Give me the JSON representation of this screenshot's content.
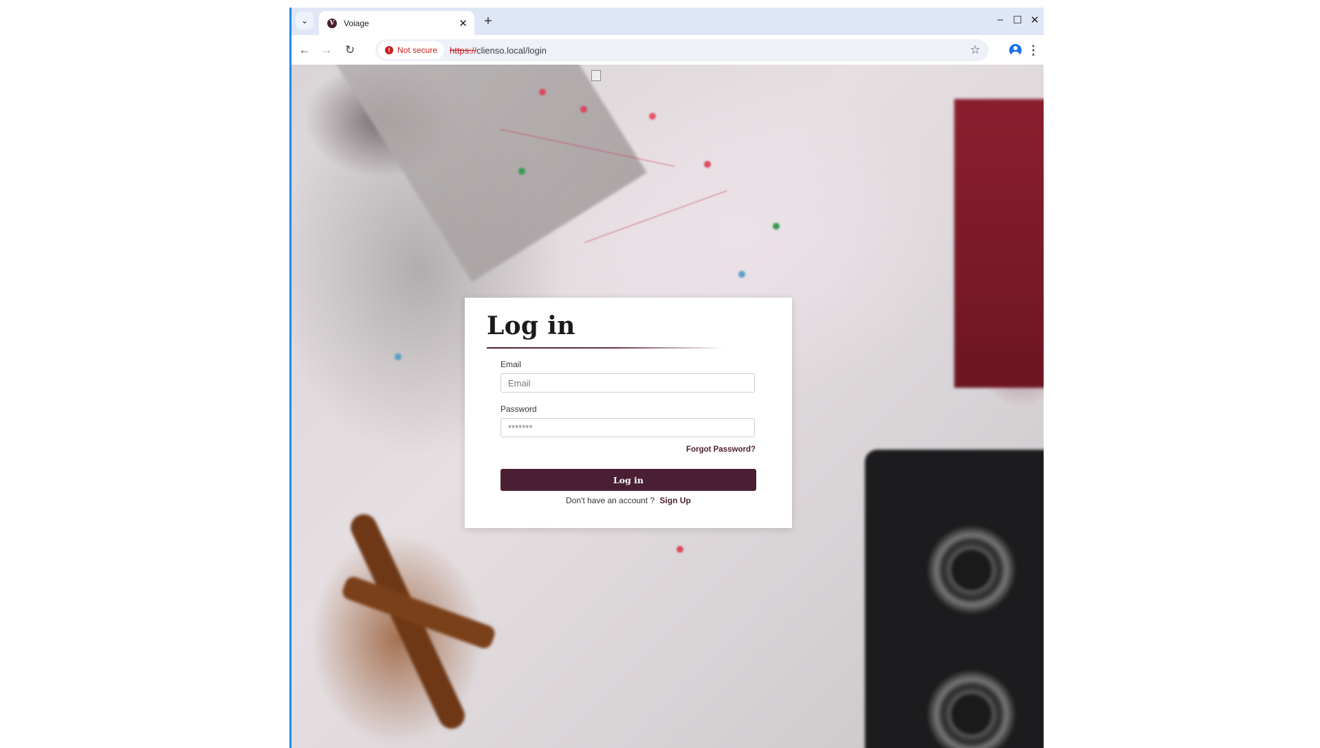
{
  "browser": {
    "tab_title": "Voiage",
    "tab_close": "✕",
    "new_tab": "+",
    "security_label": "Not secure",
    "url_scheme": "https://",
    "url_rest": "clienso.local/login"
  },
  "login": {
    "title": "Log in",
    "email_label": "Email",
    "email_placeholder": "Email",
    "password_label": "Password",
    "password_placeholder": "*******",
    "forgot_password": "Forgot Password?",
    "submit_label": "Log in",
    "no_account_text": "Don't have an account ?",
    "signup_label": "Sign Up"
  },
  "colors": {
    "brand": "#4a1f33",
    "warning": "#c5221f"
  }
}
